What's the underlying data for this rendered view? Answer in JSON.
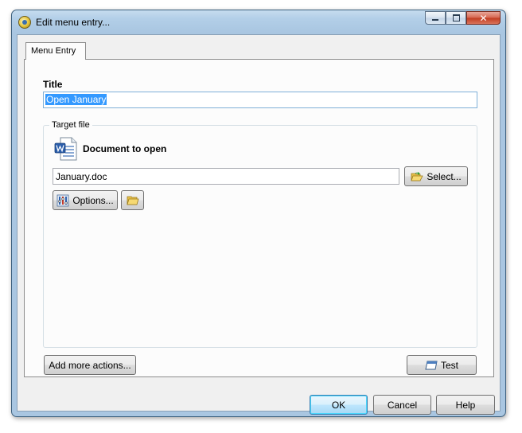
{
  "window": {
    "title": "Edit menu entry..."
  },
  "tabs": [
    {
      "label": "Menu Entry"
    }
  ],
  "form": {
    "title_label": "Title",
    "title_value": "Open January",
    "group_label": "Target file",
    "doc_heading": "Document to open",
    "file_value": "January.doc",
    "select_label": "Select...",
    "options_label": "Options...",
    "add_more_label": "Add more actions...",
    "test_label": "Test"
  },
  "footer": {
    "ok_label": "OK",
    "cancel_label": "Cancel",
    "help_label": "Help"
  },
  "icons": {
    "app": "app-icon",
    "word_document": "word-document-icon",
    "folder_arrow": "folder-open-arrow-icon",
    "options": "options-icon",
    "folder": "folder-icon",
    "test": "test-window-icon"
  },
  "colors": {
    "selection": "#3399ff",
    "close_button": "#c03b20",
    "titlebar": "#b3cfe8"
  }
}
